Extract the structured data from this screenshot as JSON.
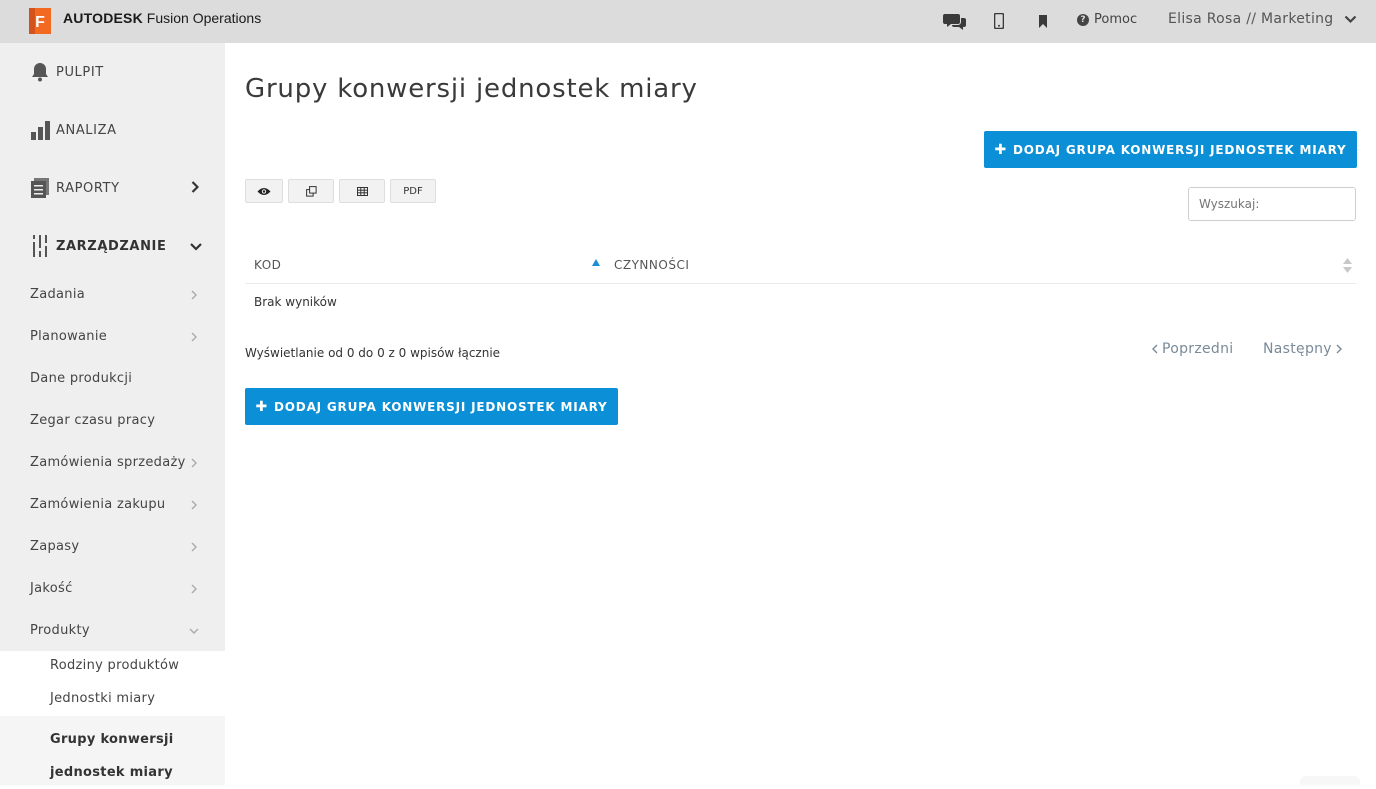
{
  "brand": {
    "logo_letter": "F",
    "name_bold": "AUTODESK",
    "name_rest": " Fusion Operations"
  },
  "topbar": {
    "icons": [
      "chat-icon",
      "mobile-icon",
      "bookmark-icon"
    ],
    "help_label": "Pomoc",
    "user_label": "Elisa Rosa // Marketing"
  },
  "sidebar": {
    "main": [
      {
        "label": "PULPIT",
        "icon": "bell-icon"
      },
      {
        "label": "ANALIZA",
        "icon": "bar-chart-icon"
      },
      {
        "label": "RAPORTY",
        "icon": "report-icon"
      },
      {
        "label": "ZARZĄDZANIE",
        "icon": "sliders-icon"
      }
    ],
    "sub": [
      "Zadania",
      "Planowanie",
      "Dane produkcji",
      "Zegar czasu pracy",
      "Zamówienia sprzedaży",
      "Zamówienia zakupu",
      "Zapasy",
      "Jakość",
      "Produkty"
    ],
    "children": [
      "Rodziny produktów",
      "Jednostki miary",
      "Grupy konwersji",
      "jednostek miary"
    ]
  },
  "main": {
    "title": "Grupy konwersji jednostek miary",
    "add_button": "DODAJ GRUPA KONWERSJI JEDNOSTEK MIARY",
    "pdf_label": "PDF",
    "search_placeholder": "Wyszukaj:",
    "columns": [
      "KOD",
      "CZYNNOŚCI"
    ],
    "empty_text": "Brak wyników",
    "info_text": "Wyświetlanie od 0 do 0 z 0 wpisów łącznie",
    "prev_label": "Poprzedni",
    "next_label": "Następny"
  },
  "colors": {
    "accent": "#0b8fd6",
    "topbar": "#dcdcdc",
    "sidebar": "#efefef",
    "logo": "#f26a22"
  }
}
